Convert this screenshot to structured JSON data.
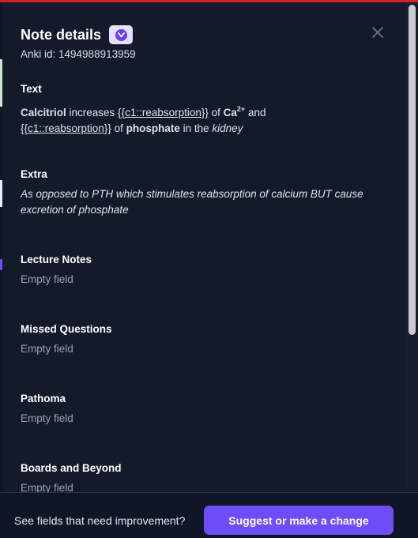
{
  "header": {
    "title": "Note details",
    "anki_id": "Anki id: 1494988913959"
  },
  "fields": {
    "text": {
      "label": "Text",
      "part1_bold": "Calcitriol",
      "part2": " increases ",
      "cloze1": "{{c1::reabsorption}}",
      "part3": " of ",
      "ca_bold": "Ca",
      "ca_sup": "2+",
      "part4": " and",
      "cloze2": "{{c1::reabsorption}}",
      "part5": " of ",
      "phosphate_bold": "phosphate",
      "part6": " in the ",
      "kidney_italic": "kidney"
    },
    "extra": {
      "label": "Extra",
      "value": "As opposed to PTH which stimulates reabsorption of calcium BUT cause excretion of phosphate"
    },
    "lecture_notes": {
      "label": "Lecture Notes",
      "value": "Empty field"
    },
    "missed_questions": {
      "label": "Missed Questions",
      "value": "Empty field"
    },
    "pathoma": {
      "label": "Pathoma",
      "value": "Empty field"
    },
    "boards_and_beyond": {
      "label": "Boards and Beyond",
      "value": "Empty field"
    }
  },
  "footer": {
    "prompt": "See fields that need improvement?",
    "suggest_label": "Suggest or make a change"
  },
  "colors": {
    "accent": "#6e4cf6",
    "background": "#131b2b",
    "top_bar": "#d11f2a"
  },
  "icons": {
    "brand": "brand-badge-icon",
    "close": "close-icon"
  }
}
